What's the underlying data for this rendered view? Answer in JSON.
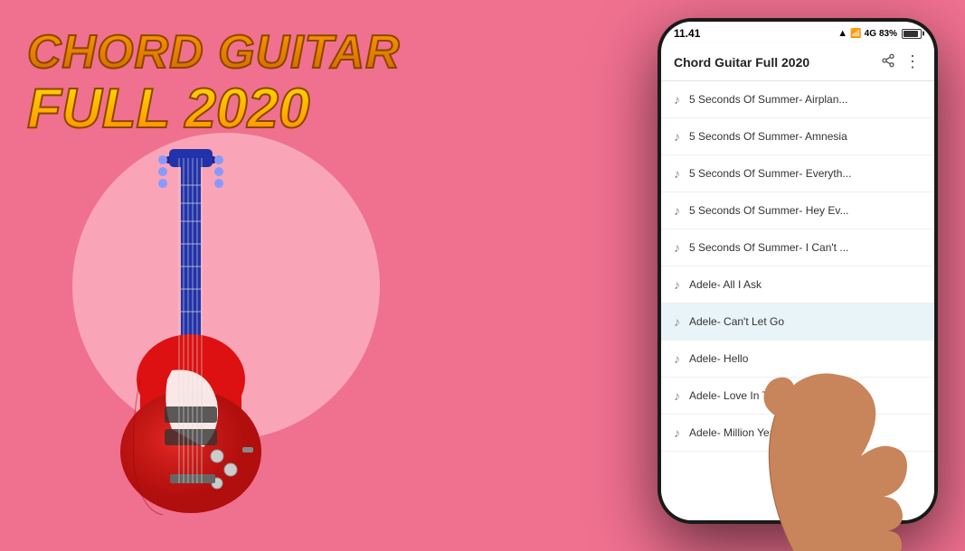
{
  "app": {
    "title": "Chord Guitar Full 2020",
    "title_line1": "Chord Guitar",
    "title_line2": "Full 2020",
    "bg_color": "#f07090"
  },
  "status_bar": {
    "time": "11.41",
    "signal": "4G",
    "battery": "83%"
  },
  "header": {
    "title": "Chord Guitar Full 2020",
    "share_icon": "share",
    "more_icon": "more"
  },
  "songs": [
    {
      "id": 1,
      "name": "5 Seconds Of Summer- Airplan...",
      "selected": false
    },
    {
      "id": 2,
      "name": "5 Seconds Of Summer- Amnesia",
      "selected": false
    },
    {
      "id": 3,
      "name": "5 Seconds Of Summer- Everyth...",
      "selected": false
    },
    {
      "id": 4,
      "name": "5 Seconds Of Summer- Hey Ev...",
      "selected": false
    },
    {
      "id": 5,
      "name": "5 Seconds Of Summer- I Can't ...",
      "selected": false
    },
    {
      "id": 6,
      "name": "Adele- All I Ask",
      "selected": false
    },
    {
      "id": 7,
      "name": "Adele- Can't Let Go",
      "selected": true
    },
    {
      "id": 8,
      "name": "Adele- Hello",
      "selected": false
    },
    {
      "id": 9,
      "name": "Adele- Love In The Dark",
      "selected": false
    },
    {
      "id": 10,
      "name": "Adele- Million Years Ago",
      "selected": false
    }
  ],
  "colors": {
    "title_orange": "#ff9900",
    "title_yellow": "#ffdd00",
    "guitar_red": "#e02020",
    "bg_pink": "#f07090",
    "circle_pink": "rgba(255,200,210,0.6)"
  }
}
